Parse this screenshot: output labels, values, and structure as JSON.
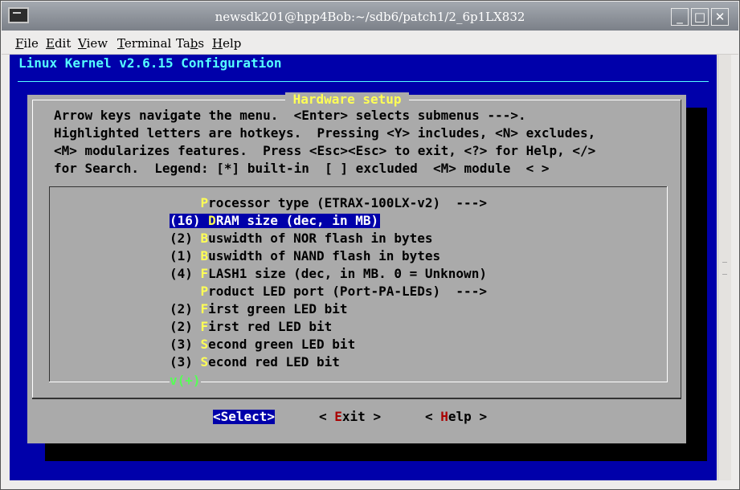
{
  "window": {
    "title": "newsdk201@hpp4Bob:~/sdb6/patch1/2_6p1LX832",
    "buttons": {
      "minimize": "_",
      "maximize": "□",
      "close": "✕"
    }
  },
  "menubar": [
    {
      "hotkey": "F",
      "rest": "ile"
    },
    {
      "hotkey": "E",
      "rest": "dit"
    },
    {
      "hotkey": "V",
      "rest": "iew"
    },
    {
      "hotkey": "T",
      "rest": "erminal"
    },
    {
      "pre": "Ta",
      "hotkey": "b",
      "rest": "s"
    },
    {
      "hotkey": "H",
      "rest": "elp"
    }
  ],
  "terminal": {
    "heading": "Linux Kernel v2.6.15 Configuration",
    "dialog": {
      "title": " Hardware setup ",
      "help_lines": [
        "Arrow keys navigate the menu.  <Enter> selects submenus --->.",
        "Highlighted letters are hotkeys.  Pressing <Y> includes, <N> excludes,",
        "<M> modularizes features.  Press <Esc><Esc> to exit, <?> for Help, </>",
        "for Search.  Legend: [*] built-in  [ ] excluded  <M> module  < >"
      ],
      "items": [
        {
          "prefix": "    ",
          "hotkey": "P",
          "rest": "rocessor type (ETRAX-100LX-v2)  --->"
        },
        {
          "prefix": "(16) ",
          "hotkey": "D",
          "rest": "RAM size (dec, in MB)"
        },
        {
          "prefix": "(2) ",
          "hotkey": "B",
          "rest": "uswidth of NOR flash in bytes"
        },
        {
          "prefix": "(1) ",
          "hotkey": "B",
          "rest": "uswidth of NAND flash in bytes"
        },
        {
          "prefix": "(4) ",
          "hotkey": "F",
          "rest": "LASH1 size (dec, in MB. 0 = Unknown)"
        },
        {
          "prefix": "    ",
          "hotkey": "P",
          "rest": "roduct LED port (Port-PA-LEDs)  --->"
        },
        {
          "prefix": "(2) ",
          "hotkey": "F",
          "rest": "irst green LED bit"
        },
        {
          "prefix": "(2) ",
          "hotkey": "F",
          "rest": "irst red LED bit"
        },
        {
          "prefix": "(3) ",
          "hotkey": "S",
          "rest": "econd green LED bit"
        },
        {
          "prefix": "(3) ",
          "hotkey": "S",
          "rest": "econd red LED bit"
        }
      ],
      "more_indicator": "v(+)",
      "buttons": {
        "select": "<Select>",
        "exit_pre": "< ",
        "exit_hotkey": "E",
        "exit_rest": "xit >",
        "help_pre": "< ",
        "help_hotkey": "H",
        "help_rest": "elp >"
      }
    }
  },
  "colors": {
    "terminal_bg": "#0000aa",
    "dialog_bg": "#aaaaaa",
    "heading": "#55ffff",
    "hotkey": "#ffff55",
    "selection_bg": "#0000aa",
    "button_hotkey": "#aa0000",
    "more_indicator": "#55ff55"
  }
}
